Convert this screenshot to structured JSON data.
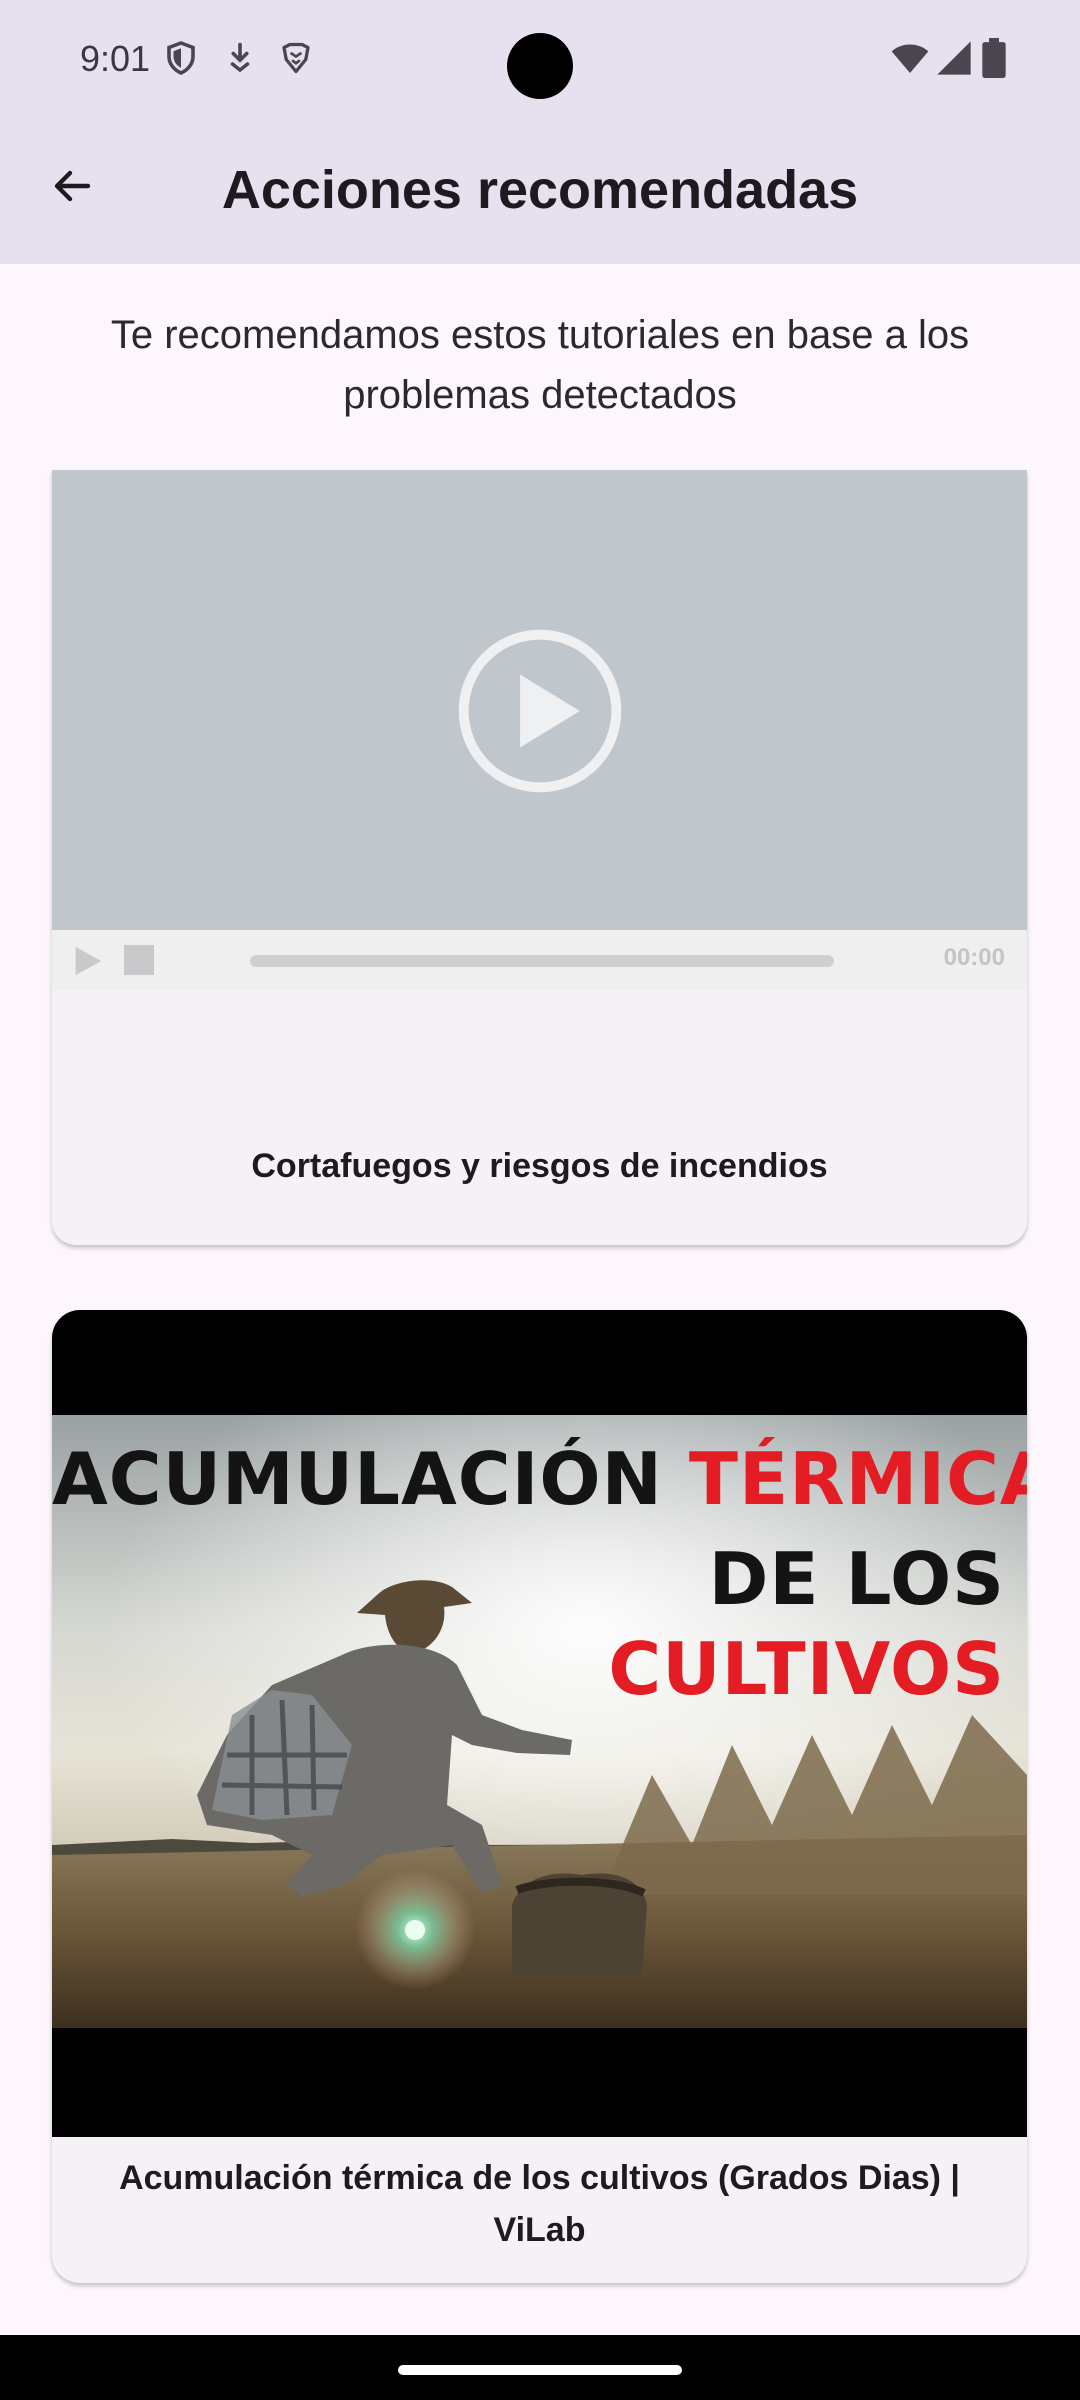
{
  "status_bar": {
    "time": "9:01",
    "left_icons": [
      "vpn-shield-icon",
      "download-icon",
      "brave-lion-icon"
    ],
    "right_icons": [
      "wifi-icon",
      "cell-signal-icon",
      "battery-icon"
    ]
  },
  "app_bar": {
    "back_icon": "arrow-left-icon",
    "title": "Acciones recomendadas",
    "background": "#e7e0ee"
  },
  "intro_text": "Te recomendamos estos tutoriales en base a los problemas detectados",
  "videos": [
    {
      "title": "Cortafuegos y riesgos de incendios",
      "player": {
        "state": "not-loaded",
        "time": "00:00",
        "progress": 0
      }
    },
    {
      "title": "Acumulación térmica de los cultivos (Grados Dias) | ViLab",
      "thumbnail": {
        "line1_dark": "ACUMULACIÓN ",
        "line1_red": "TÉRMICA",
        "line2": "DE LOS",
        "line3": "CULTIVOS"
      }
    }
  ],
  "colors": {
    "page_bg": "#fdf7fd",
    "card_bg": "#f5f1f6",
    "video_placeholder": "#bfc6cc",
    "thumbnail_red": "#e41d25"
  }
}
